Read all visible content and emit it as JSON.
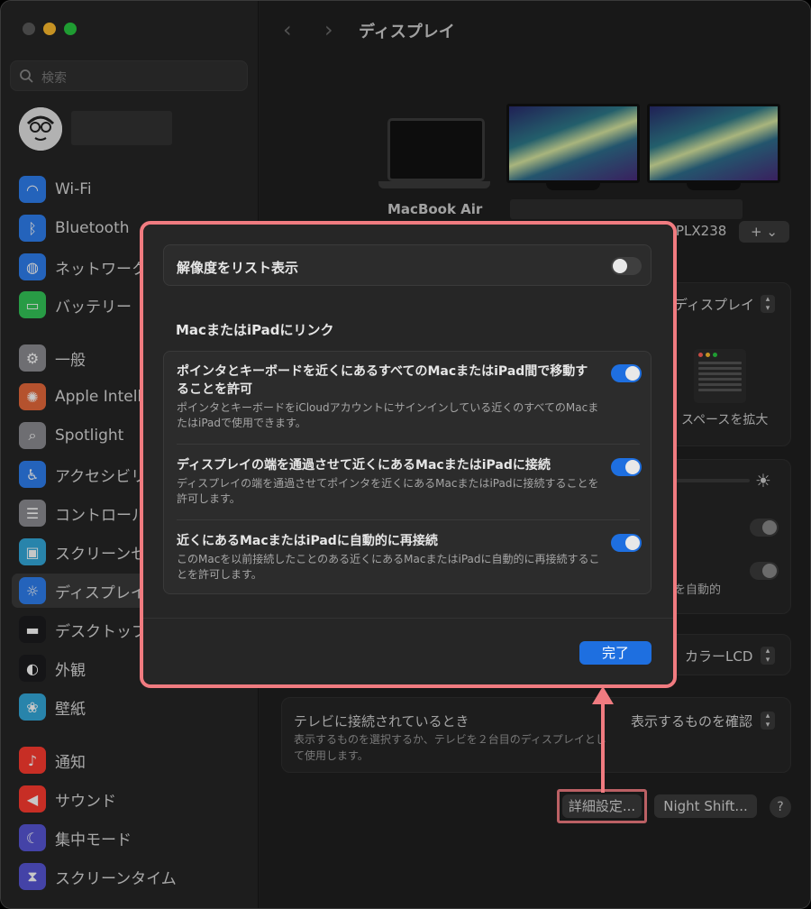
{
  "sidebar": {
    "search_placeholder": "検索",
    "items": [
      {
        "label": "Wi-Fi",
        "icon": "wifi-icon",
        "color": "#2f7ff0"
      },
      {
        "label": "Bluetooth",
        "icon": "bluetooth-icon",
        "color": "#2f7ff0"
      },
      {
        "label": "ネットワーク",
        "icon": "globe-icon",
        "color": "#2f7ff0"
      },
      {
        "label": "バッテリー",
        "icon": "battery-icon",
        "color": "#34c759"
      },
      {
        "label": "一般",
        "icon": "gear-icon",
        "color": "#8e8e93"
      },
      {
        "label": "Apple Intelligence",
        "icon": "apple-intelligence-icon",
        "color": "#e86a3c"
      },
      {
        "label": "Spotlight",
        "icon": "magnifier-icon",
        "color": "#8e8e93"
      },
      {
        "label": "アクセシビリティ",
        "icon": "accessibility-icon",
        "color": "#2f7ff0"
      },
      {
        "label": "コントロールセンター",
        "icon": "control-center-icon",
        "color": "#8e8e93"
      },
      {
        "label": "スクリーンセーバ",
        "icon": "screensaver-icon",
        "color": "#34aadc"
      },
      {
        "label": "ディスプレイ",
        "icon": "sun-icon",
        "color": "#2f7ff0"
      },
      {
        "label": "デスクトップとDock",
        "icon": "dock-icon",
        "color": "#1c1c1e"
      },
      {
        "label": "外観",
        "icon": "appearance-icon",
        "color": "#1c1c1e"
      },
      {
        "label": "壁紙",
        "icon": "wallpaper-icon",
        "color": "#34aadc"
      },
      {
        "label": "通知",
        "icon": "bell-icon",
        "color": "#ff3b30"
      },
      {
        "label": "サウンド",
        "icon": "speaker-icon",
        "color": "#ff3b30"
      },
      {
        "label": "集中モード",
        "icon": "moon-icon",
        "color": "#5856d6"
      },
      {
        "label": "スクリーンタイム",
        "icon": "hourglass-icon",
        "color": "#5856d6"
      }
    ]
  },
  "header": {
    "back": "‹",
    "forward": "›",
    "title": "ディスプレイ"
  },
  "displays": {
    "laptop_label": "MacBook Air",
    "monitor_id": "PLX238",
    "add_button": "+ ⌄"
  },
  "settings": {
    "main_display_value": "ディスプレイ",
    "more_space_label": "スペースを拡大",
    "auto_brightness_partial": "を自動的",
    "color_profile_value": "カラーLCD",
    "tv_title": "テレビに接続されているとき",
    "tv_desc": "表示するものを選択するか、テレビを２台目のディスプレイとして使用します。",
    "tv_value": "表示するものを確認",
    "advanced_button": "詳細設定...",
    "night_shift_button": "Night Shift...",
    "help_button": "?"
  },
  "modal": {
    "resolution_list_label": "解像度をリスト表示",
    "resolution_list_on": false,
    "link_section_title": "MacまたはiPadにリンク",
    "link_options": [
      {
        "title": "ポインタとキーボードを近くにあるすべてのMacまたはiPad間で移動することを許可",
        "desc": "ポインタとキーボードをiCloudアカウントにサインインしている近くのすべてのMacまたはiPadで使用できます。",
        "on": true
      },
      {
        "title": "ディスプレイの端を通過させて近くにあるMacまたはiPadに接続",
        "desc": "ディスプレイの端を通過させてポインタを近くにあるMacまたはiPadに接続することを許可します。",
        "on": true
      },
      {
        "title": "近くにあるMacまたはiPadに自動的に再接続",
        "desc": "このMacを以前接続したことのある近くにあるMacまたはiPadに自動的に再接続することを許可します。",
        "on": true
      }
    ],
    "done_button": "完了"
  }
}
